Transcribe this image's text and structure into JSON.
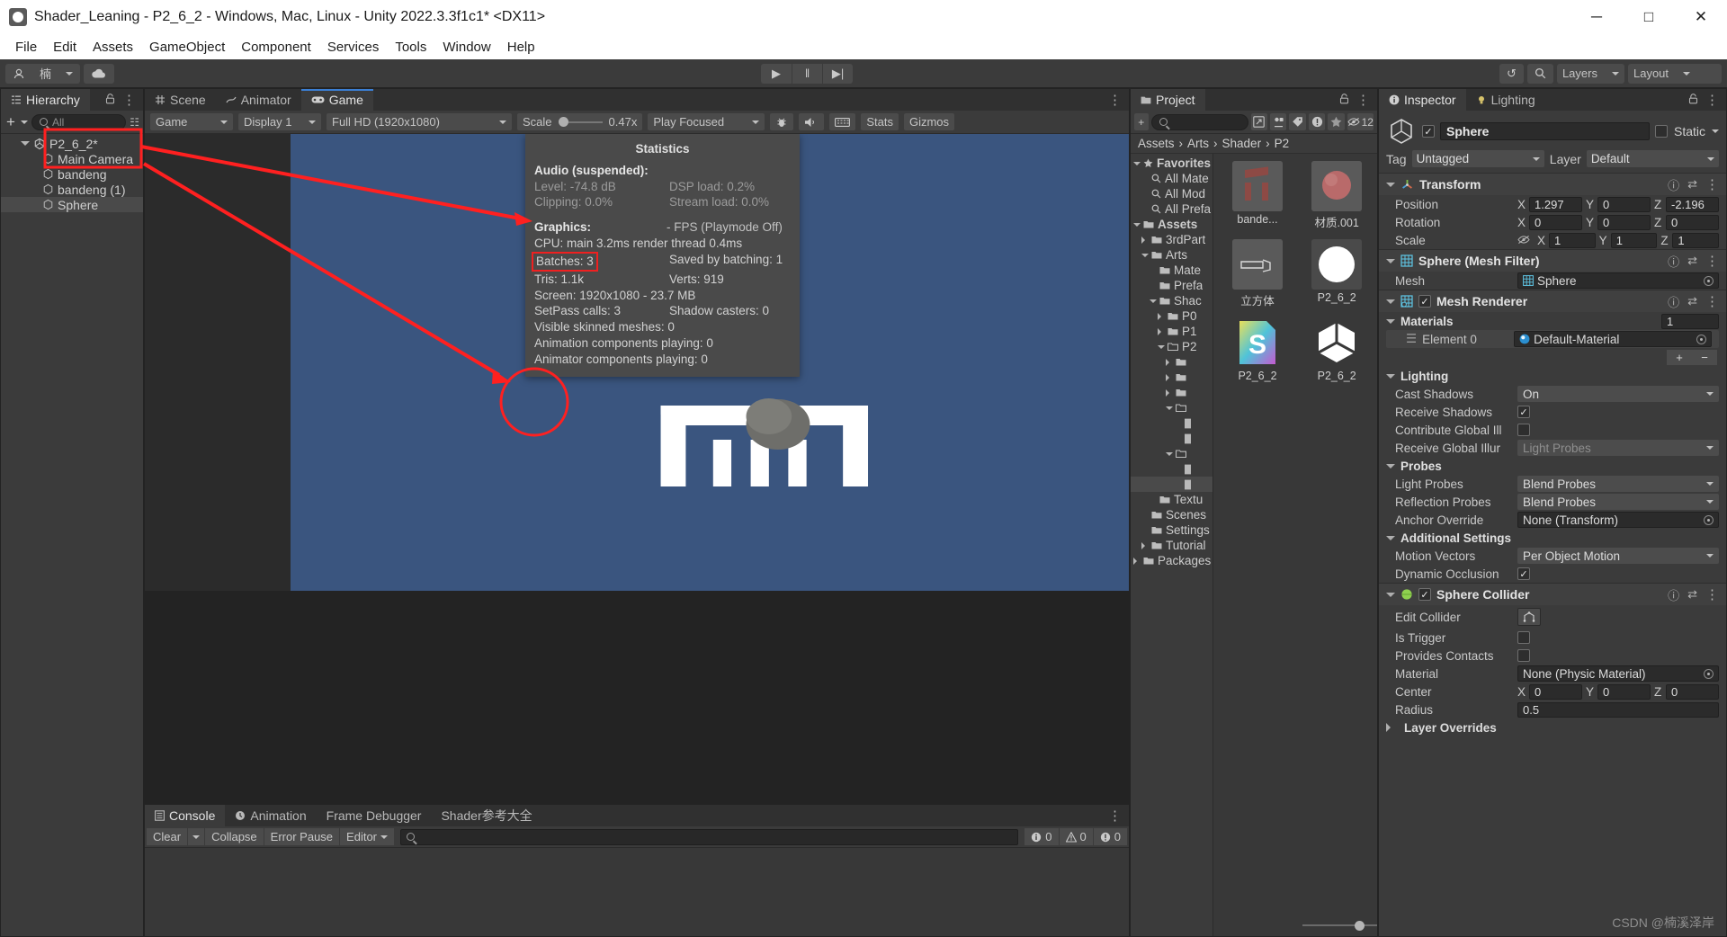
{
  "window": {
    "title": "Shader_Leaning - P2_6_2 - Windows, Mac, Linux - Unity 2022.3.3f1c1* <DX11>",
    "minimize": "─",
    "maximize": "□",
    "close": "✕"
  },
  "menu": [
    "File",
    "Edit",
    "Assets",
    "GameObject",
    "Component",
    "Services",
    "Tools",
    "Window",
    "Help"
  ],
  "toolbar": {
    "account_label": "楠",
    "cloud_icon": "cloud-icon",
    "play": "▶",
    "pause": "‖",
    "step": "▶|",
    "history_icon": "↺",
    "search_icon": "⌕",
    "layers": "Layers",
    "layout": "Layout"
  },
  "hierarchy": {
    "tab": "Hierarchy",
    "add_label": "+",
    "search_placeholder": "All",
    "root": "P2_6_2*",
    "items": [
      {
        "label": "Main Camera",
        "selected": false
      },
      {
        "label": "bandeng",
        "selected": false
      },
      {
        "label": "bandeng (1)",
        "selected": false
      },
      {
        "label": "Sphere",
        "selected": true
      }
    ]
  },
  "sceneview": {
    "tabs": [
      {
        "label": "Scene",
        "icon": "grid-icon",
        "active": false
      },
      {
        "label": "Animator",
        "icon": "animator-icon",
        "active": false
      },
      {
        "label": "Game",
        "icon": "gamepad-icon",
        "active": true
      }
    ],
    "toolbar": {
      "view": "Game",
      "display": "Display 1",
      "resolution": "Full HD (1920x1080)",
      "scale_label": "Scale",
      "scale_value": "0.47x",
      "play_mode": "Play Focused",
      "mute_icon": "mute-audio-icon",
      "bug_icon": "bug-icon",
      "stats": "Stats",
      "gizmos": "Gizmos"
    }
  },
  "statistics": {
    "title": "Statistics",
    "audio_header": "Audio (suspended):",
    "audio": [
      {
        "left": "Level: -74.8 dB",
        "right": "DSP load: 0.2%"
      },
      {
        "left": "Clipping: 0.0%",
        "right": "Stream load: 0.0%"
      }
    ],
    "graphics_header": "Graphics:",
    "fps_note": "- FPS (Playmode Off)",
    "cpu": "CPU: main 3.2ms  render thread 0.4ms",
    "batches_label": "Batches: 3",
    "saved_by_batching": "Saved by batching: 1",
    "tris": "Tris: 1.1k",
    "verts": "Verts: 919",
    "screen": "Screen: 1920x1080 - 23.7 MB",
    "setpass": "SetPass calls: 3",
    "shadow_casters": "Shadow casters: 0",
    "skinned": "Visible skinned meshes: 0",
    "anim_components": "Animation components playing: 0",
    "animator_components": "Animator components playing: 0"
  },
  "console": {
    "tabs": [
      {
        "label": "Console",
        "active": true
      },
      {
        "label": "Animation",
        "active": false
      },
      {
        "label": "Frame Debugger",
        "active": false
      },
      {
        "label": "Shader参考大全",
        "active": false
      }
    ],
    "clear": "Clear",
    "collapse": "Collapse",
    "error_pause": "Error Pause",
    "editor": "Editor",
    "search_placeholder": "",
    "counts": {
      "log": "0",
      "warning": "0",
      "error": "0"
    }
  },
  "project": {
    "tab": "Project",
    "search_placeholder": "",
    "hidden_count": "12",
    "breadcrumb": [
      "Assets",
      "Arts",
      "Shader",
      "P2"
    ],
    "tree": [
      {
        "label": "Favorites",
        "depth": 0,
        "type": "header",
        "arrow": "down"
      },
      {
        "label": "All Mate",
        "depth": 1,
        "type": "search"
      },
      {
        "label": "All Mod",
        "depth": 1,
        "type": "search"
      },
      {
        "label": "All Prefa",
        "depth": 1,
        "type": "search"
      },
      {
        "label": "Assets",
        "depth": 0,
        "type": "header",
        "arrow": "down"
      },
      {
        "label": "3rdPart",
        "depth": 1,
        "type": "folder",
        "arrow": "right"
      },
      {
        "label": "Arts",
        "depth": 1,
        "type": "folder",
        "arrow": "down"
      },
      {
        "label": "Mate",
        "depth": 2,
        "type": "folder"
      },
      {
        "label": "Prefa",
        "depth": 2,
        "type": "folder"
      },
      {
        "label": "Shac",
        "depth": 2,
        "type": "folder",
        "arrow": "down"
      },
      {
        "label": "P0",
        "depth": 3,
        "type": "folder",
        "arrow": "right"
      },
      {
        "label": "P1",
        "depth": 3,
        "type": "folder",
        "arrow": "right"
      },
      {
        "label": "P2",
        "depth": 3,
        "type": "folder-open",
        "arrow": "down"
      },
      {
        "label": "",
        "depth": 4,
        "type": "folder",
        "arrow": "right"
      },
      {
        "label": "",
        "depth": 4,
        "type": "folder",
        "arrow": "right"
      },
      {
        "label": "",
        "depth": 4,
        "type": "folder",
        "arrow": "right"
      },
      {
        "label": "",
        "depth": 4,
        "type": "folder-open",
        "arrow": "down"
      },
      {
        "label": "",
        "depth": 5,
        "type": "file"
      },
      {
        "label": "",
        "depth": 5,
        "type": "file"
      },
      {
        "label": "",
        "depth": 4,
        "type": "folder-open",
        "arrow": "down"
      },
      {
        "label": "",
        "depth": 5,
        "type": "file"
      },
      {
        "label": "",
        "depth": 5,
        "type": "file",
        "selected": true
      },
      {
        "label": "Textu",
        "depth": 2,
        "type": "folder"
      },
      {
        "label": "Scenes",
        "depth": 1,
        "type": "folder"
      },
      {
        "label": "Settings",
        "depth": 1,
        "type": "folder"
      },
      {
        "label": "Tutorial",
        "depth": 1,
        "type": "folder",
        "arrow": "right"
      },
      {
        "label": "Packages",
        "depth": 0,
        "type": "folder",
        "arrow": "right"
      }
    ],
    "assets": [
      {
        "label": "bande...",
        "kind": "model"
      },
      {
        "label": "材质.001",
        "kind": "material"
      },
      {
        "label": "立方体",
        "kind": "mesh"
      },
      {
        "label": "P2_6_2",
        "kind": "material-white"
      },
      {
        "label": "P2_6_2",
        "kind": "shader"
      },
      {
        "label": "P2_6_2",
        "kind": "prefab"
      }
    ]
  },
  "inspector": {
    "tabs": [
      {
        "label": "Inspector",
        "active": true
      },
      {
        "label": "Lighting",
        "active": false
      }
    ],
    "object_name": "Sphere",
    "enabled": true,
    "static_label": "Static",
    "tag_label": "Tag",
    "tag_value": "Untagged",
    "layer_label": "Layer",
    "layer_value": "Default",
    "transform": {
      "title": "Transform",
      "rows": [
        {
          "label": "Position",
          "x": "1.297",
          "y": "0",
          "z": "-2.196"
        },
        {
          "label": "Rotation",
          "x": "0",
          "y": "0",
          "z": "0"
        },
        {
          "label": "Scale",
          "x": "1",
          "y": "1",
          "z": "1",
          "icon": "eye-off-icon"
        }
      ]
    },
    "mesh_filter": {
      "title": "Sphere (Mesh Filter)",
      "mesh_label": "Mesh",
      "mesh_value": "Sphere"
    },
    "mesh_renderer": {
      "title": "Mesh Renderer",
      "enabled": true,
      "materials_label": "Materials",
      "materials_count": "1",
      "element_label": "Element 0",
      "element_value": "Default-Material",
      "add_label": "+",
      "remove_label": "−",
      "lighting_label": "Lighting",
      "cast_shadows_label": "Cast Shadows",
      "cast_shadows_value": "On",
      "receive_shadows_label": "Receive Shadows",
      "receive_shadows": true,
      "contribute_gi_label": "Contribute Global Ill",
      "contribute_gi": false,
      "receive_gi_label": "Receive Global Illur",
      "receive_gi_value": "Light Probes",
      "probes_label": "Probes",
      "light_probes_label": "Light Probes",
      "light_probes_value": "Blend Probes",
      "reflection_probes_label": "Reflection Probes",
      "reflection_probes_value": "Blend Probes",
      "anchor_override_label": "Anchor Override",
      "anchor_override_value": "None (Transform)",
      "additional_label": "Additional Settings",
      "motion_vectors_label": "Motion Vectors",
      "motion_vectors_value": "Per Object Motion",
      "dynamic_occlusion_label": "Dynamic Occlusion",
      "dynamic_occlusion": true
    },
    "sphere_collider": {
      "title": "Sphere Collider",
      "enabled": true,
      "edit_collider_label": "Edit Collider",
      "is_trigger_label": "Is Trigger",
      "is_trigger": false,
      "provides_contacts_label": "Provides Contacts",
      "provides_contacts": false,
      "material_label": "Material",
      "material_value": "None (Physic Material)",
      "center_label": "Center",
      "center": {
        "x": "0",
        "y": "0",
        "z": "0"
      },
      "radius_label": "Radius",
      "radius_value": "0.5",
      "layer_overrides_label": "Layer Overrides"
    }
  },
  "watermark": "CSDN @楠溪泽岸",
  "colors": {
    "accent": "#3b7fd4",
    "annotation": "#ff2020",
    "game_bg": "#3a557f",
    "panel_bg": "#3b3b3b"
  }
}
